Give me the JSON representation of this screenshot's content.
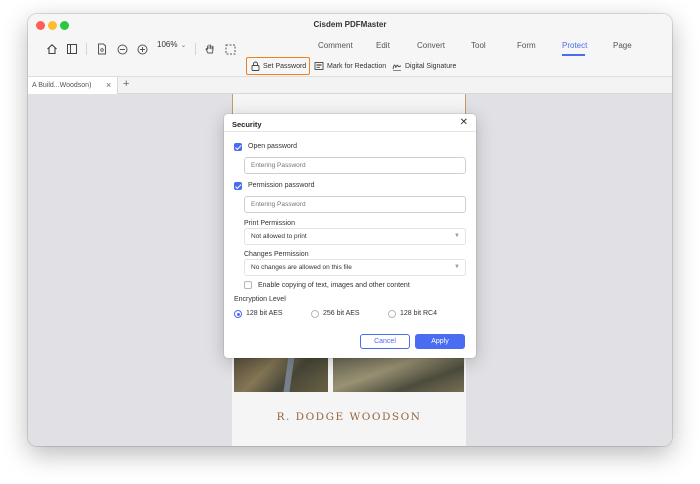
{
  "window": {
    "title": "Cisdem PDFMaster"
  },
  "toolbar": {
    "zoom": "106%",
    "menu": [
      {
        "label": "Comment",
        "active": false
      },
      {
        "label": "Edit",
        "active": false
      },
      {
        "label": "Convert",
        "active": false
      },
      {
        "label": "Tool",
        "active": false
      },
      {
        "label": "Form",
        "active": false
      },
      {
        "label": "Protect",
        "active": true
      },
      {
        "label": "Page",
        "active": false
      }
    ],
    "subtools": {
      "set_password": "Set Password",
      "mark_redaction": "Mark for Redaction",
      "digital_signature": "Digital Signature"
    }
  },
  "tabs": {
    "doc_tab": "A Build...Woodson)"
  },
  "document": {
    "author": "R. DODGE WOODSON"
  },
  "dialog": {
    "title": "Security",
    "open_password": {
      "label": "Open password",
      "checked": true,
      "placeholder": "Entering Password"
    },
    "permission_password": {
      "label": "Permission password",
      "checked": true,
      "placeholder": "Entering Password"
    },
    "print_permission": {
      "label": "Print Permission",
      "value": "Not allowed to print"
    },
    "changes_permission": {
      "label": "Changes Permission",
      "value": "No changes are allowed on this file"
    },
    "enable_copying": {
      "label": "Enable copying of text, images and other content",
      "checked": false
    },
    "encryption": {
      "label": "Encryption Level",
      "options": [
        {
          "label": "128 bit AES",
          "selected": true
        },
        {
          "label": "256 bit AES",
          "selected": false
        },
        {
          "label": "128 bit RC4",
          "selected": false
        }
      ]
    },
    "cancel_label": "Cancel",
    "apply_label": "Apply"
  },
  "colors": {
    "accent": "#4a6cf0",
    "highlight": "#f08022",
    "author_text": "#9a6a45"
  }
}
